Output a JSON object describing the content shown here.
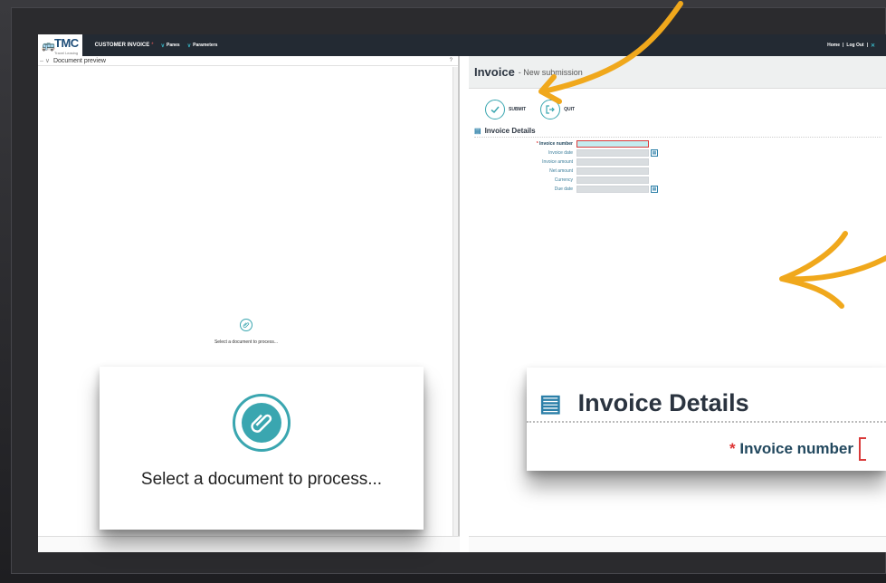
{
  "topbar": {
    "logo_text": "TMC",
    "logo_sub": "Travel Leasing",
    "app_title": "CUSTOMER INVOICE",
    "title_marker": "*",
    "menu_panes": "Panes",
    "menu_parameters": "Parameters",
    "home_link": "Home",
    "separator": "|",
    "logout_link": "Log Out",
    "close_glyph": "✕"
  },
  "left_pane": {
    "header_label": "Document preview",
    "help_mark": "?",
    "empty_message": "Select a document to process..."
  },
  "right_pane": {
    "title": "Invoice",
    "subtitle": "- New submission",
    "submit_label": "SUBMIT",
    "quit_label": "QUIT",
    "section_title": "Invoice Details",
    "fields": [
      {
        "label": "Invoice number",
        "required": true,
        "calendar": false
      },
      {
        "label": "Invoice date",
        "required": false,
        "calendar": true
      },
      {
        "label": "Invoice amount",
        "required": false,
        "calendar": false
      },
      {
        "label": "Net amount",
        "required": false,
        "calendar": false
      },
      {
        "label": "Currency",
        "required": false,
        "calendar": false
      },
      {
        "label": "Due date",
        "required": false,
        "calendar": true
      }
    ]
  },
  "zoom_left": {
    "message": "Select a document to process..."
  },
  "zoom_right": {
    "title": "Invoice Details",
    "field_label": "Invoice number",
    "required_marker": "*"
  },
  "colors": {
    "accent": "#3aa6b0",
    "navbar": "#232a33",
    "arrow": "#f0a81c",
    "required": "#d93a3a"
  },
  "icons": [
    "bus-logo-icon",
    "paperclip-icon",
    "check-icon",
    "exit-icon",
    "book-icon",
    "calendar-icon",
    "chevron-down-icon",
    "close-icon"
  ]
}
